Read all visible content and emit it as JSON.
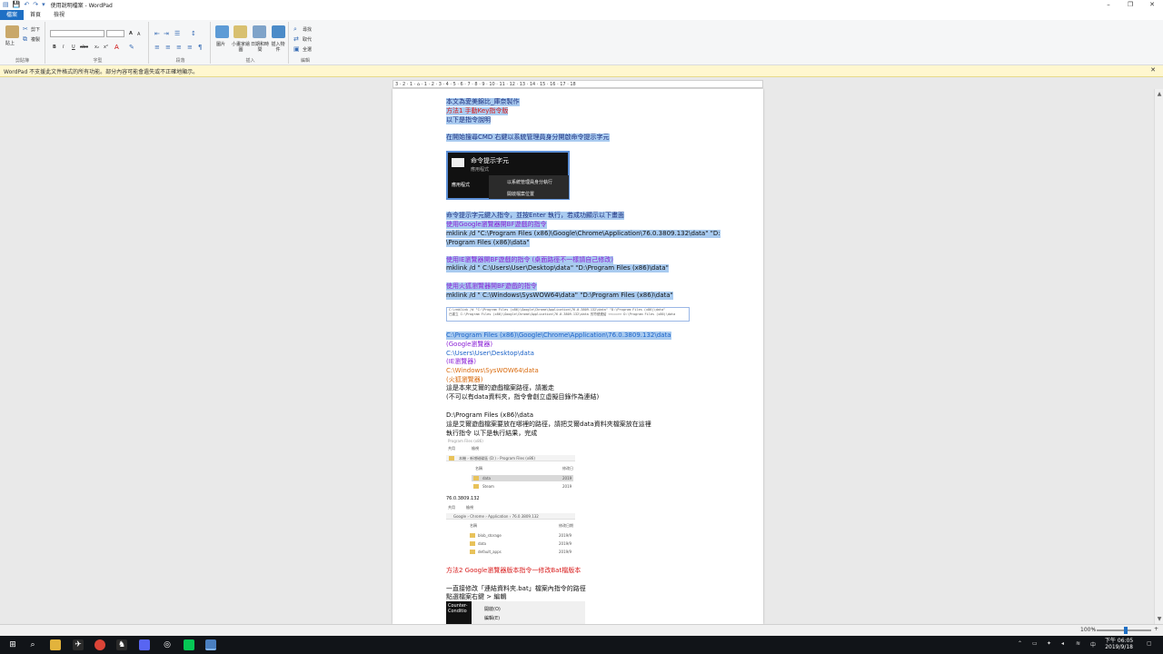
{
  "window": {
    "title": "使用說明檔案 - WordPad",
    "minimize": "–",
    "maximize": "❐",
    "close": "✕"
  },
  "ribbon": {
    "tabs": [
      "檔案",
      "首頁",
      "檢視"
    ],
    "clipboard": {
      "paste": "貼上",
      "cut": "剪下",
      "copy": "複製",
      "label": "剪貼簿"
    },
    "font": {
      "label": "字型",
      "grow": "A",
      "shrink": "A",
      "bold": "B",
      "italic": "I",
      "underline": "U",
      "strike": "abc",
      "sub": "x₂",
      "sup": "x²"
    },
    "paragraph": {
      "label": "段落"
    },
    "insert": {
      "picture": "圖片",
      "paint": "小畫家繪圖",
      "datetime": "日期和時間",
      "object": "插入物件",
      "label": "插入"
    },
    "editing": {
      "find": "尋找",
      "replace": "取代",
      "select_all": "全選",
      "label": "編輯"
    }
  },
  "infobar": {
    "text": "WordPad 不支援此文件格式的所有功能。部分內容可能會遺失或不正確地顯示。",
    "close": "✕"
  },
  "ruler": {
    "text": "3 · 2 · 1 · ⌂ · 1 · 2 · 3 · 4 · 5 · 6 · 7 · 8 · 9 · 10 · 11 · 12 · 13 · 14 · 15 · 16 · 17 · 18"
  },
  "document": {
    "l1": "本文為愛美錦比_庫奈製作",
    "l2": "方法1 手動Key指令版",
    "l3": "以下是指令說明",
    "l4": "在開始搜尋CMD 右鍵以系統管理員身分開啟命令提示字元",
    "cmd_image": {
      "title": "命令提示字元",
      "subtitle": "應用程式",
      "section": "應用程式",
      "menu1": "以系統管理員身分執行",
      "menu2": "開啟檔案位置"
    },
    "l5": "命令提示字元鍵入指令，並按Enter 執行，若成功顯示以下畫面",
    "l6": "使用Google瀏覽器開BF遊戲的指令",
    "l7": "mklink /d \"C:\\Program Files (x86)\\Google\\Chrome\\Application\\76.0.3809.132\\data\" \"D:",
    "l8": "\\Program Files (x86)\\data\"",
    "l9": "使用IE瀏覽器開BF遊戲的指令 (桌面路徑不一樣請自己修改)",
    "l10": "mklink /d \" C:\\Users\\User\\Desktop\\data\" \"D:\\Program Files (x86)\\data\"",
    "l11": "使用火狐瀏覽器開BF遊戲的指令",
    "l12": "mklink /d \" C:\\Windows\\SysWOW64\\data\" \"D:\\Program Files (x86)\\data\"",
    "console": {
      "c1": "C:\\>mklink /d \"C:\\Program Files (x86)\\Google\\Chrome\\Application\\76.0.3809.132\\data\" \"D:\\Program Files (x86)\\data\"",
      "c2": "已建立 C:\\Program Files (x86)\\Google\\Chrome\\Application\\76.0.3809.132\\data 的符號連結 <<===>> D:\\Program Files (x86)\\data"
    },
    "l13": "C:\\Program Files (x86)\\Google\\Chrome\\Application\\76.0.3809.132\\data",
    "l14": "(Google瀏覽器)",
    "l15": "C:\\Users\\User\\Desktop\\data",
    "l16": "(IE瀏覽器)",
    "l17": "C:\\Windows\\SysWOW64\\data",
    "l18": "(火狐瀏覽器)",
    "l19": "這是本來艾爾的遊戲檔案路徑，請搬走",
    "l20": "(不可以有data資料夾，指令會創立虛擬目錄作為連結)",
    "l21": "D:\\Program Files (x86)\\data",
    "l22": "這是艾爾遊戲檔案要放在哪裡的路徑，請把艾爾data資料夾檔案放在這裡",
    "l23": "執行指令 以下是執行結果，完成",
    "explorer1": {
      "caption": "Program Files (x86)",
      "menu1": "共用",
      "menu2": "檢視",
      "path": "本機 › 新增磁碟區 (D:) › Program Files (x86)",
      "col_name": "名稱",
      "col_date": "修改日",
      "item1": "data",
      "item2": "Steam",
      "date1": "2019",
      "date2": "2019"
    },
    "version_label": "76.0.3809.132",
    "explorer2": {
      "menu1": "共用",
      "menu2": "檢視",
      "path": "Google › Chrome › Application › 76.0.3809.132",
      "col_name": "名稱",
      "col_date": "修改日期",
      "item1": "blob_storage",
      "item2": "data",
      "item3": "default_apps",
      "date1": "2019/9",
      "date2": "2019/9",
      "date3": "2019/9"
    },
    "l24": "方法2 Google瀏覽器版本指令一修改Bat檔版本",
    "l25": "一直接修改「連結資料夾.bat」檔案內指令的路徑",
    "l26": "點選檔案右鍵 > 編輯",
    "ctx": {
      "dark1": "Counter-",
      "dark2": "Conditio",
      "item1": "開啟(O)",
      "item2": "編輯(E)"
    }
  },
  "statusbar": {
    "zoom": "100%",
    "zoom_out": "–",
    "zoom_in": "+",
    "zoom_level": 100
  },
  "taskbar": {
    "time": "下午 06:05",
    "date": "2019/9/18"
  },
  "colors": {
    "selection": "#a9cbf0",
    "accent": "#1e6fc4",
    "red": "#d81b1b",
    "purple": "#8a1fd6"
  }
}
